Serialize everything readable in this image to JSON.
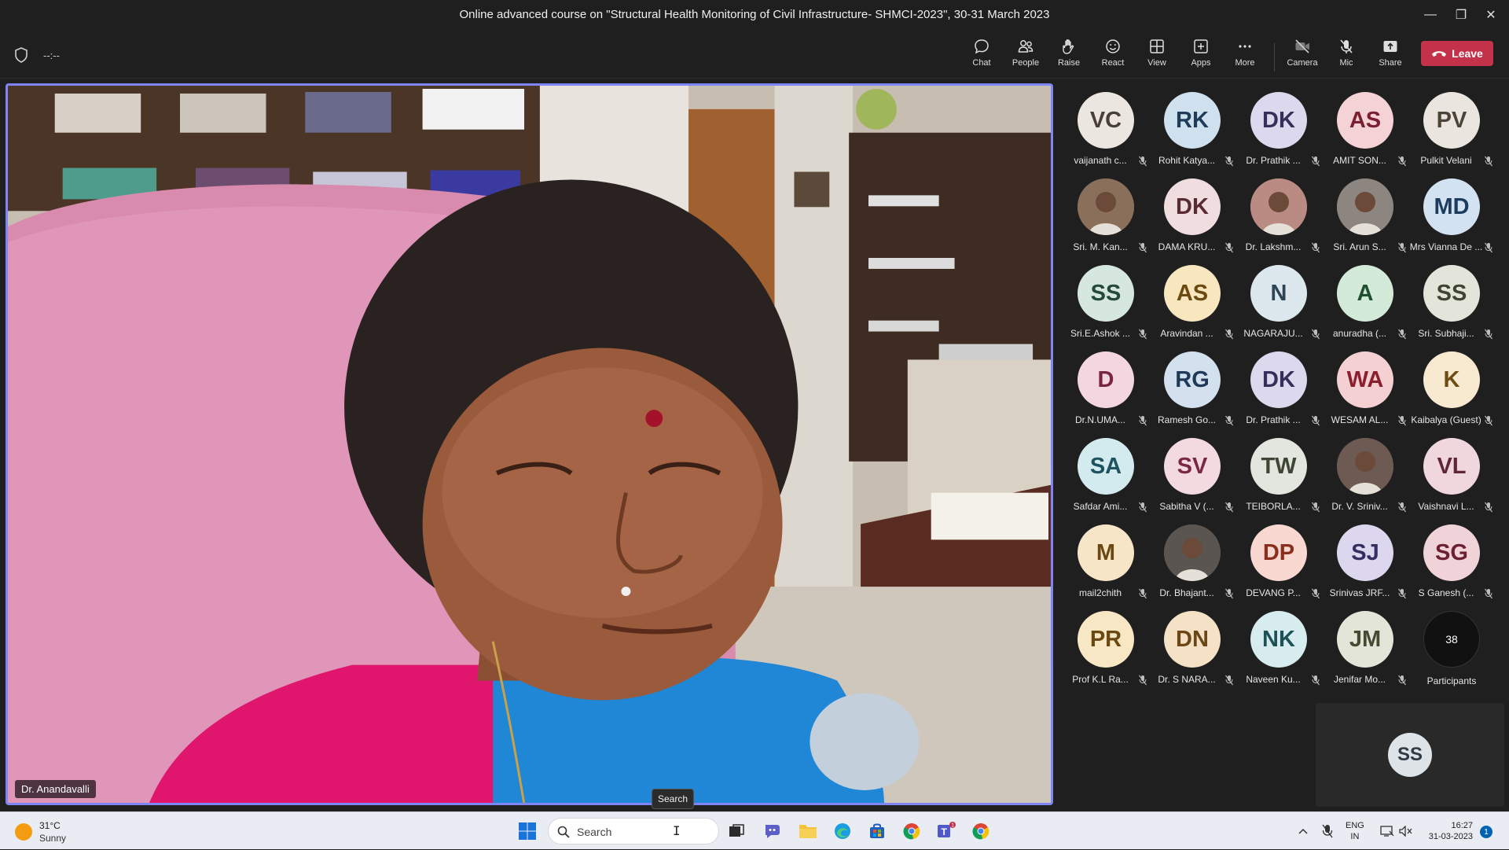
{
  "window": {
    "title": "Online advanced course on \"Structural Health Monitoring of Civil Infrastructure- SHMCI-2023\", 30-31 March 2023",
    "minimize": "—",
    "restore": "❐",
    "close": "✕"
  },
  "toolbar": {
    "timer": "--:--",
    "buttons": [
      {
        "label": "Chat",
        "icon": "chat-icon"
      },
      {
        "label": "People",
        "icon": "people-icon"
      },
      {
        "label": "Raise",
        "icon": "raise-hand-icon"
      },
      {
        "label": "React",
        "icon": "react-icon"
      },
      {
        "label": "View",
        "icon": "view-icon"
      },
      {
        "label": "Apps",
        "icon": "apps-icon"
      },
      {
        "label": "More",
        "icon": "more-icon"
      },
      {
        "label": "Camera",
        "icon": "camera-off-icon"
      },
      {
        "label": "Mic",
        "icon": "mic-off-icon"
      },
      {
        "label": "Share",
        "icon": "share-icon"
      }
    ],
    "leave_label": "Leave",
    "leave_color": "#c4314b"
  },
  "main_video": {
    "speaker_name": "Dr. Anandavalli",
    "border_color": "#7f85f5"
  },
  "participants": [
    {
      "initials": "VC",
      "name": "vaijanath c...",
      "bg": "#ece6e1",
      "fg": "#4a3f38"
    },
    {
      "initials": "RK",
      "name": "Rohit Katya...",
      "bg": "#cfe0ee",
      "fg": "#1f3c58"
    },
    {
      "initials": "DK",
      "name": "Dr. Prathik ...",
      "bg": "#dcd9ee",
      "fg": "#34305a"
    },
    {
      "initials": "AS",
      "name": "AMIT SON...",
      "bg": "#f4d2d6",
      "fg": "#7a2030"
    },
    {
      "initials": "PV",
      "name": "Pulkit Velani",
      "bg": "#eae6df",
      "fg": "#4d4438"
    },
    {
      "initials": "",
      "name": "Sri. M. Kan...",
      "bg": "#8a6f5a",
      "fg": "#fff",
      "photo": true
    },
    {
      "initials": "DK",
      "name": "DAMA KRU...",
      "bg": "#efdde0",
      "fg": "#5a2a33"
    },
    {
      "initials": "",
      "name": "Dr. Lakshm...",
      "bg": "#b98b83",
      "fg": "#fff",
      "photo": true
    },
    {
      "initials": "",
      "name": "Sri. Arun S...",
      "bg": "#8d8580",
      "fg": "#fff",
      "photo": true
    },
    {
      "initials": "MD",
      "name": "Mrs Vianna De ...",
      "bg": "#d2e2f1",
      "fg": "#1c3c5e"
    },
    {
      "initials": "SS",
      "name": "Sri.E.Ashok ...",
      "bg": "#d6e7df",
      "fg": "#244a39"
    },
    {
      "initials": "AS",
      "name": "Aravindan ...",
      "bg": "#f8e6be",
      "fg": "#6b4a12"
    },
    {
      "initials": "N",
      "name": "NAGARAJU...",
      "bg": "#dde7ee",
      "fg": "#2d4656"
    },
    {
      "initials": "A",
      "name": "anuradha (...",
      "bg": "#d4ead9",
      "fg": "#1f5030"
    },
    {
      "initials": "SS",
      "name": "Sri. Subhaji...",
      "bg": "#e3e5da",
      "fg": "#3f4533"
    },
    {
      "initials": "D",
      "name": "Dr.N.UMA...",
      "bg": "#f3d6df",
      "fg": "#7a2443"
    },
    {
      "initials": "RG",
      "name": "Ramesh Go...",
      "bg": "#d3e1ee",
      "fg": "#1f3a58"
    },
    {
      "initials": "DK",
      "name": "Dr. Prathik ...",
      "bg": "#dcd9ee",
      "fg": "#34305a"
    },
    {
      "initials": "WA",
      "name": "WESAM AL...",
      "bg": "#f4d0d3",
      "fg": "#8a1f2e"
    },
    {
      "initials": "K",
      "name": "Kaibalya (Guest)",
      "bg": "#f8ead0",
      "fg": "#6e4b14"
    },
    {
      "initials": "SA",
      "name": "Safdar Ami...",
      "bg": "#d3ebee",
      "fg": "#1e5360"
    },
    {
      "initials": "SV",
      "name": "Sabitha V (...",
      "bg": "#f3dae0",
      "fg": "#7a2843"
    },
    {
      "initials": "TW",
      "name": "TEIBORLA...",
      "bg": "#e2e6df",
      "fg": "#3d4535"
    },
    {
      "initials": "",
      "name": "Dr. V. Sriniv...",
      "bg": "#6d5a52",
      "fg": "#fff",
      "photo": true
    },
    {
      "initials": "VL",
      "name": "Vaishnavi L...",
      "bg": "#efd7dd",
      "fg": "#5f2638"
    },
    {
      "initials": "M",
      "name": "mail2chith",
      "bg": "#f6e5c6",
      "fg": "#6a4714"
    },
    {
      "initials": "",
      "name": "Dr. Bhajant...",
      "bg": "#5a5550",
      "fg": "#fff",
      "photo": true
    },
    {
      "initials": "DP",
      "name": "DEVANG P...",
      "bg": "#f8d8d0",
      "fg": "#8a2e1e"
    },
    {
      "initials": "SJ",
      "name": "Srinivas JRF...",
      "bg": "#dcd7ee",
      "fg": "#352e60"
    },
    {
      "initials": "SG",
      "name": "S Ganesh (...",
      "bg": "#efd3d8",
      "fg": "#6b2033"
    },
    {
      "initials": "PR",
      "name": "Prof K.L Ra...",
      "bg": "#f8e7c4",
      "fg": "#6b4812"
    },
    {
      "initials": "DN",
      "name": "Dr. S NARA...",
      "bg": "#f5e2c6",
      "fg": "#6a4715"
    },
    {
      "initials": "NK",
      "name": "Naveen Ku...",
      "bg": "#d6ecef",
      "fg": "#1e5058"
    },
    {
      "initials": "JM",
      "name": "Jenifar Mo...",
      "bg": "#e3e5d8",
      "fg": "#454a33"
    }
  ],
  "more_participants": {
    "count": "38",
    "label": "Participants"
  },
  "self_view": {
    "initials": "SS"
  },
  "tooltip": "Search",
  "taskbar": {
    "weather_temp": "31°C",
    "weather_desc": "Sunny",
    "search_placeholder": "Search",
    "lang_line1": "ENG",
    "lang_line2": "IN",
    "time": "16:27",
    "date": "31-03-2023",
    "notifications": "1"
  }
}
